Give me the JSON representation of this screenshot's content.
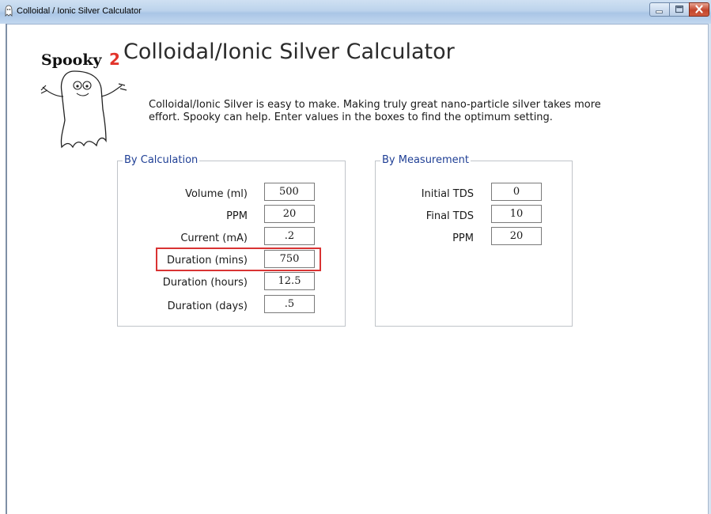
{
  "window": {
    "title": "Colloidal / Ionic Silver Calculator",
    "controls": [
      "minimize-icon",
      "maximize-icon",
      "close-icon"
    ]
  },
  "header": {
    "logo_text": "Spooky",
    "logo_mark": "2",
    "title": "Colloidal/Ionic Silver Calculator",
    "intro_line1": "Colloidal/Ionic Silver is easy to make. Making truly great nano-particle silver takes more",
    "intro_line2": "effort. Spooky can help. Enter values in the boxes to find the optimum setting."
  },
  "by_calculation": {
    "legend": "By Calculation",
    "rows": [
      {
        "label": "Volume (ml)",
        "value": "500"
      },
      {
        "label": "PPM",
        "value": "20"
      },
      {
        "label": "Current (mA)",
        "value": ".2"
      },
      {
        "label": "Duration (mins)",
        "value": "750"
      },
      {
        "label": "Duration (hours)",
        "value": "12.5"
      },
      {
        "label": "Duration (days)",
        "value": ".5"
      }
    ]
  },
  "by_measurement": {
    "legend": "By Measurement",
    "rows": [
      {
        "label": "Initial TDS",
        "value": "0"
      },
      {
        "label": "Final TDS",
        "value": "10"
      },
      {
        "label": "PPM",
        "value": "20"
      }
    ]
  },
  "colors": {
    "legend_text": "#1f3f95",
    "highlight": "#d93333",
    "logo_mark": "#e2342b"
  }
}
